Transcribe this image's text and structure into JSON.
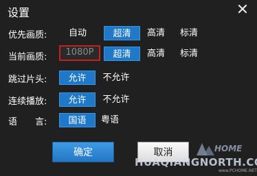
{
  "dialog": {
    "title": "设置",
    "close_icon": "close-icon"
  },
  "preferred_quality": {
    "label": "优先画质:",
    "options": [
      "自动",
      "超清",
      "高清",
      "标清"
    ],
    "selected": "超清"
  },
  "current_quality": {
    "label": "当前画质:",
    "current_value": "1080P",
    "options": [
      "超清",
      "高清",
      "标清"
    ],
    "selected": "超清"
  },
  "skip_intro": {
    "label": "跳过片头:",
    "options": [
      "允许",
      "不允许"
    ],
    "selected": "允许"
  },
  "continuous_play": {
    "label": "连续播放:",
    "options": [
      "允许",
      "不允许"
    ],
    "selected": "允许"
  },
  "language": {
    "label": "语　　言:",
    "options": [
      "国语",
      "粤语"
    ],
    "selected": "国语"
  },
  "buttons": {
    "confirm": "确定",
    "cancel": "取消"
  },
  "watermark": {
    "text": "HUAQIANGNORTH.COM",
    "sub": "www.PCHOME.NET",
    "logo_text": "HOME"
  },
  "colors": {
    "background": "#202020",
    "selected_blue": "#1f78c8",
    "current_border_red": "#c8201f"
  }
}
